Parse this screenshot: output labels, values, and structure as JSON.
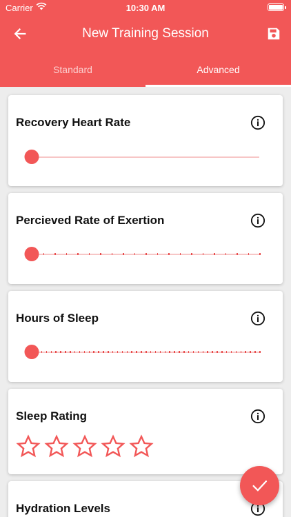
{
  "status_bar": {
    "carrier": "Carrier",
    "time": "10:30 AM"
  },
  "app_bar": {
    "title": "New Training Session",
    "back_icon": "arrow-left-icon",
    "save_icon": "floppy-save-icon"
  },
  "tabs": [
    {
      "label": "Standard",
      "selected": false
    },
    {
      "label": "Advanced",
      "selected": true
    }
  ],
  "cards": {
    "recovery_heart_rate": {
      "title": "Recovery Heart Rate",
      "slider_value": 0
    },
    "perceived_exertion": {
      "title": "Percieved Rate of Exertion",
      "slider_value": 0,
      "steps": 20
    },
    "hours_of_sleep": {
      "title": "Hours of Sleep",
      "slider_value": 0,
      "steps": 48
    },
    "sleep_rating": {
      "title": "Sleep Rating",
      "stars_total": 5,
      "stars_filled": 0
    },
    "hydration_levels": {
      "title": "Hydration Levels"
    }
  },
  "fab": {
    "icon": "check-icon"
  },
  "colors": {
    "accent": "#f25757",
    "track": "#f7c6c6",
    "background": "#ededed"
  }
}
